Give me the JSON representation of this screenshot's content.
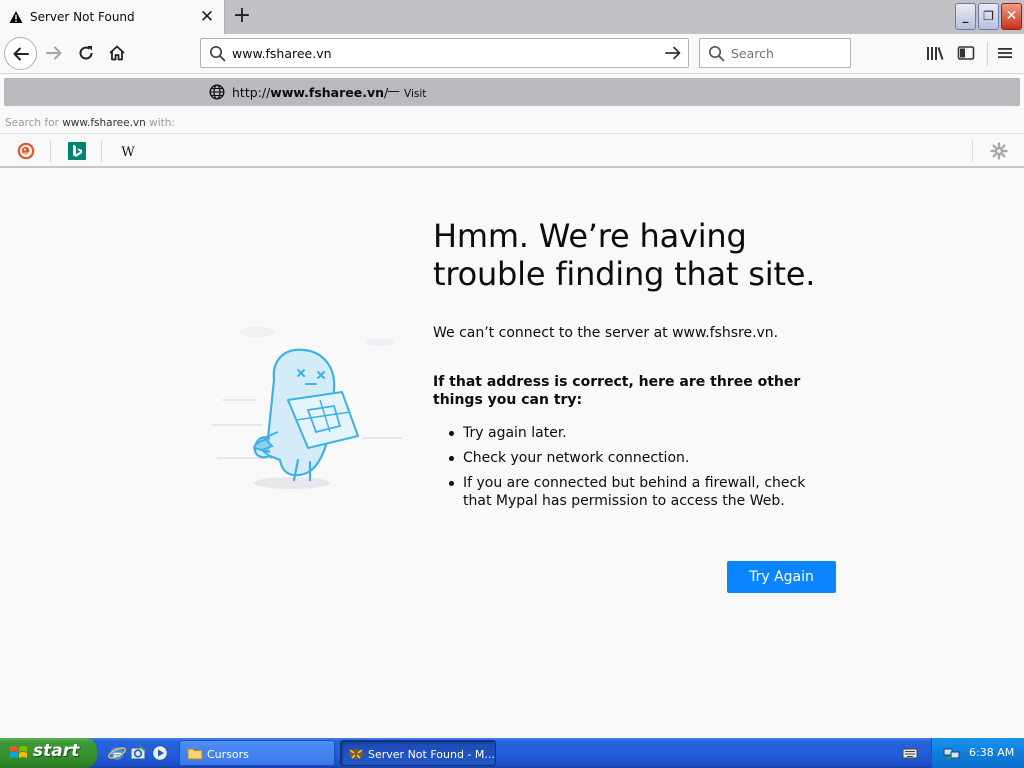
{
  "browser": {
    "tab": {
      "title": "Server Not Found",
      "close_icon": "close-icon"
    },
    "url_value": "www.fsharee.vn",
    "search_placeholder": "Search"
  },
  "dropdown": {
    "visit_prefix": "http://",
    "visit_host": "www.fsharee.vn",
    "visit_suffix": "/",
    "dash": "—",
    "visit_action": "Visit",
    "search_for_prefix": "Search for ",
    "search_for_term": "www.fsharee.vn",
    "search_for_suffix": " with:",
    "engines": [
      "duckduckgo-icon",
      "bing-icon",
      "wikipedia-icon"
    ]
  },
  "page": {
    "headline": "Hmm. We’re having trouble finding that site.",
    "message": "We can’t connect to the server at www.fshsre.vn.",
    "subhead": "If that address is correct, here are three other things you can try:",
    "tips": [
      "Try again later.",
      "Check your network connection.",
      "If you are connected but behind a firewall, check that Mypal has permission to access the Web."
    ],
    "try_again": "Try Again"
  },
  "taskbar": {
    "start": "start",
    "tasks": [
      "Cursors",
      "Server Not Found - M..."
    ],
    "clock": "6:38 AM"
  },
  "colors": {
    "accent": "#0a84ff",
    "taskbar_blue": "#245edb",
    "start_green": "#3c9a36",
    "tray_blue": "#0f7fdc"
  }
}
